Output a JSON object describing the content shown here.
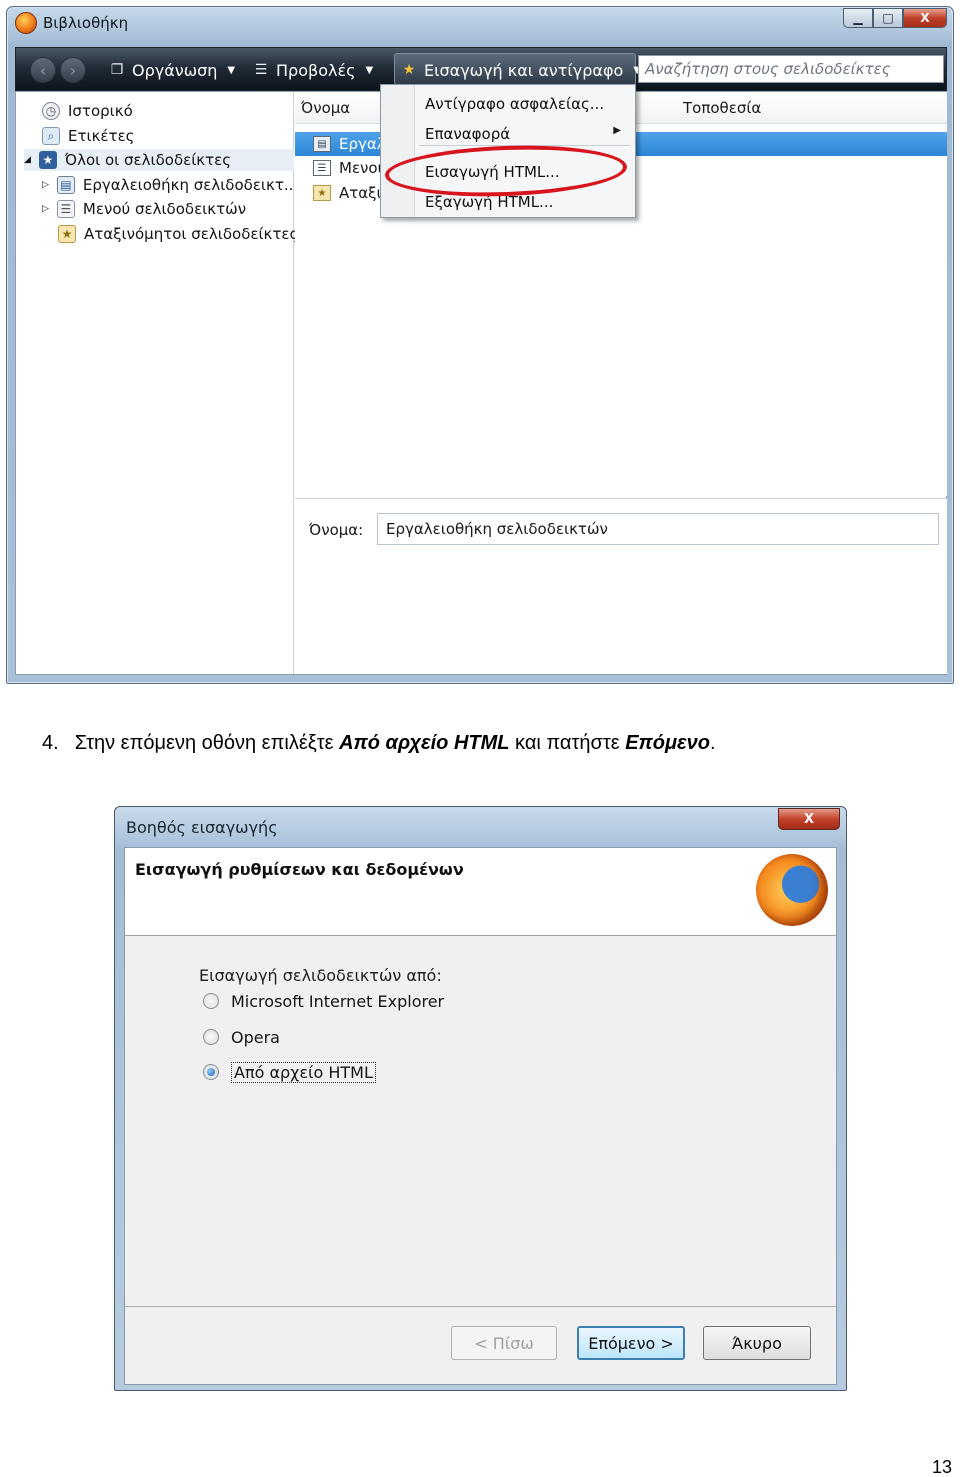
{
  "library_window": {
    "title": "Βιβλιοθήκη",
    "window_buttons": {
      "minimize": "▁",
      "maximize": "□",
      "close": "X"
    },
    "toolbar": {
      "organize_label": "Οργάνωση",
      "views_label": "Προβολές",
      "import_backup_label": "Εισαγωγή και αντίγραφο",
      "search_placeholder": "Αναζήτηση στους σελιδοδείκτες"
    },
    "sidebar": {
      "items": [
        {
          "label": "Ιστορικό"
        },
        {
          "label": "Ετικέτες"
        },
        {
          "label": "Όλοι οι σελιδοδείκτες"
        },
        {
          "label": "Εργαλειοθήκη σελιδοδεικτ..."
        },
        {
          "label": "Μενού σελιδοδεικτών"
        },
        {
          "label": "Αταξινόμητοι σελιδοδείκτες"
        }
      ]
    },
    "list": {
      "columns": {
        "name": "Όνομα",
        "location": "Τοποθεσία"
      },
      "rows": [
        {
          "label": "Εργαλε"
        },
        {
          "label": "Μενού"
        },
        {
          "label": "Αταξινό"
        }
      ]
    },
    "menu": {
      "items": [
        {
          "label": "Αντίγραφο ασφαλείας..."
        },
        {
          "label": "Επαναφορά"
        },
        {
          "label": "Εισαγωγή HTML..."
        },
        {
          "label": "Εξαγωγή HTML..."
        }
      ]
    },
    "details": {
      "name_label": "Όνομα:",
      "name_value": "Εργαλειοθήκη σελιδοδεικτών"
    }
  },
  "instruction": {
    "number": "4.",
    "part1": "Στην επόμενη οθόνη επιλέξτε ",
    "bold1": "Από αρχείο HTML",
    "part2": " και πατήστε ",
    "bold2": "Επόμενο",
    "part3": "."
  },
  "wizard": {
    "title": "Βοηθός εισαγωγής",
    "close_label": "X",
    "heading": "Εισαγωγή ρυθμίσεων και δεδομένων",
    "prompt": "Εισαγωγή σελιδοδεικτών από:",
    "options": [
      {
        "label": "Microsoft Internet Explorer",
        "selected": false
      },
      {
        "label": "Opera",
        "selected": false
      },
      {
        "label": "Από αρχείο HTML",
        "selected": true
      }
    ],
    "buttons": {
      "back": "< Πίσω",
      "next": "Επόμενο >",
      "cancel": "Άκυρο"
    }
  },
  "page_number": "13"
}
